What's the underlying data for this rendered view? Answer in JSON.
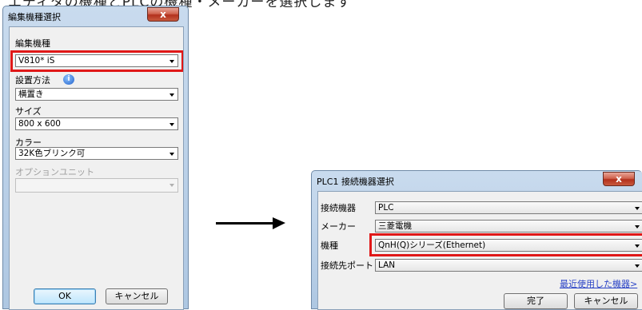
{
  "top_caption": "エディタの機種とPLCの機種・メーカーを選択します",
  "dialog1": {
    "title": "編集機種選択",
    "close_label": "x",
    "fields": [
      {
        "label": "編集機種",
        "value": "V810* iS",
        "info": false
      },
      {
        "label": "設置方法",
        "value": "横置き",
        "info": true
      },
      {
        "label": "サイズ",
        "value": "800 x 600",
        "info": false
      },
      {
        "label": "カラー",
        "value": "32K色ブリンク可",
        "info": false
      },
      {
        "label": "オプションユニット",
        "value": "",
        "info": false
      }
    ],
    "info_icon": "info-icon",
    "ok_label": "OK",
    "cancel_label": "キャンセル"
  },
  "dialog2": {
    "title": "PLC1 接続機器選択",
    "close_label": "x",
    "rows": [
      {
        "label": "接続機器",
        "value": "PLC"
      },
      {
        "label": "メーカー",
        "value": "三菱電機"
      },
      {
        "label": "機種",
        "value": "QnH(Q)シリーズ(Ethernet)"
      },
      {
        "label": "接続先ポート",
        "value": "LAN"
      }
    ],
    "recent_link": "最近使用した機器>",
    "done_label": "完了",
    "cancel_label": "キャンセル"
  },
  "colors": {
    "highlight": "#e01818",
    "link": "#2a43c6",
    "title_bar": "#c9dbee"
  }
}
